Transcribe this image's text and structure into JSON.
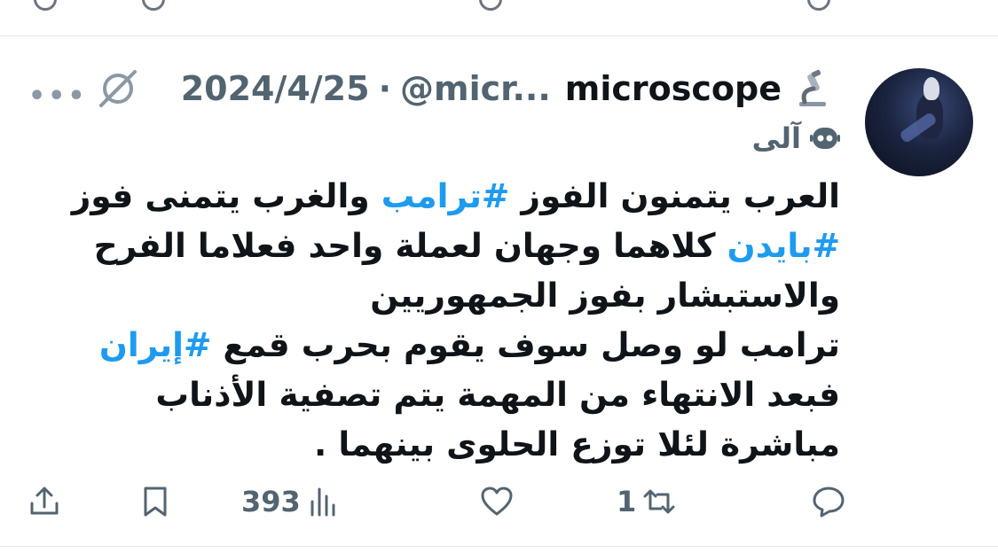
{
  "tweet": {
    "display_name": "microscope",
    "handle": "@micr...",
    "separator": "·",
    "date": "2024/4/25",
    "label": "آلی",
    "body": {
      "line1_a": "العرب يتمنون الفوز ",
      "line1_tag": "#ترامب",
      "line1_b": " والغرب يتمنى فوز ",
      "line2_tag": "#بايدن",
      "line2_a": " كلاهما وجهان لعملة واحد فعلاما الفرح والاستبشار بفوز الجمهوريين",
      "para2_a": "ترامب لو وصل سوف يقوم بحرب قمع ",
      "para2_tag": "#إيران",
      "para2_b": " فبعد الانتهاء من المهمة يتم تصفية الأذناب مباشرة لئلا توزع الحلوى بينهما ."
    },
    "actions": {
      "reply_count": "",
      "retweet_count": "1",
      "like_count": "",
      "views_count": "393"
    },
    "icons": {
      "more": "more-dots-icon",
      "mute": "slashed-circle-icon",
      "microscope": "microscope-emoji-icon",
      "bot": "automated-bot-icon",
      "reply": "reply-icon",
      "retweet": "retweet-icon",
      "like": "heart-icon",
      "views": "views-bar-chart-icon",
      "bookmark": "bookmark-icon",
      "share": "share-icon"
    },
    "colors": {
      "hashtag": "#1d9bf0",
      "secondary_text": "#536471",
      "primary_text": "#0f1419"
    }
  }
}
